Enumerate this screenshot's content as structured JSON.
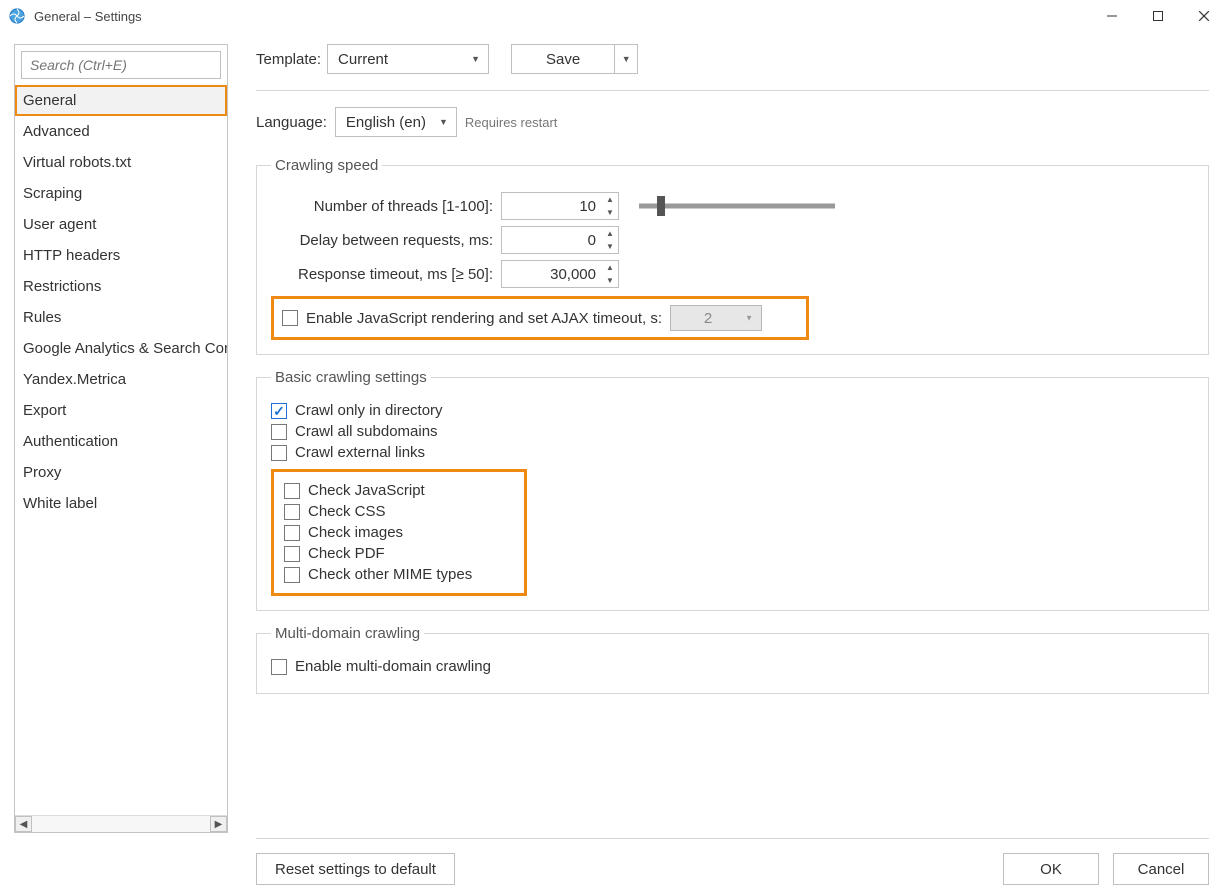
{
  "window": {
    "title": "General – Settings"
  },
  "sidebar": {
    "search_placeholder": "Search (Ctrl+E)",
    "items": [
      "General",
      "Advanced",
      "Virtual robots.txt",
      "Scraping",
      "User agent",
      "HTTP headers",
      "Restrictions",
      "Rules",
      "Google Analytics & Search Console",
      "Yandex.Metrica",
      "Export",
      "Authentication",
      "Proxy",
      "White label"
    ],
    "selected_index": 0
  },
  "template": {
    "label": "Template:",
    "value": "Current",
    "save_label": "Save"
  },
  "language": {
    "label": "Language:",
    "value": "English (en)",
    "hint": "Requires restart"
  },
  "crawling_speed": {
    "legend": "Crawling speed",
    "threads_label": "Number of threads [1-100]:",
    "threads_value": "10",
    "delay_label": "Delay between requests, ms:",
    "delay_value": "0",
    "timeout_label": "Response timeout, ms [≥ 50]:",
    "timeout_value": "30,000",
    "ajax_label": "Enable JavaScript rendering and set AJAX timeout, s:",
    "ajax_value": "2"
  },
  "basic": {
    "legend": "Basic crawling settings",
    "crawl_only_dir": "Crawl only in directory",
    "crawl_all_sub": "Crawl all subdomains",
    "crawl_external": "Crawl external links",
    "check_js": "Check JavaScript",
    "check_css": "Check CSS",
    "check_images": "Check images",
    "check_pdf": "Check PDF",
    "check_other": "Check other MIME types"
  },
  "multidomain": {
    "legend": "Multi-domain crawling",
    "enable_label": "Enable multi-domain crawling"
  },
  "footer": {
    "reset": "Reset settings to default",
    "ok": "OK",
    "cancel": "Cancel"
  }
}
